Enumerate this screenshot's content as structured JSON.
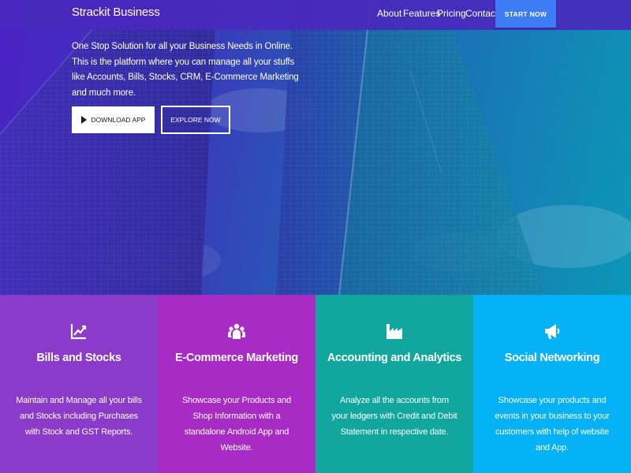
{
  "colors": {
    "nav_bg": "#4a28be",
    "cta_bg": "#3d7cf4",
    "card_1": "#8a3bc9",
    "card_2": "#a82bc6",
    "card_3": "#12a79e",
    "card_4": "#05b2f7"
  },
  "nav": {
    "brand": "Strackit Business",
    "links": [
      "About",
      "Features",
      "Pricing",
      "Contact"
    ],
    "cta": "START NOW"
  },
  "hero": {
    "tagline": "One Stop Solution for all your Business Needs in Online. This is the platform where you can manage all your stuffs like Accounts, Bills, Stocks, CRM, E-Commerce Marketing and much more.",
    "download_label": "DOWNLOAD APP",
    "explore_label": "EXPLORE NOW",
    "download_icon": "play-icon"
  },
  "features": [
    {
      "icon": "line-chart-icon",
      "title": "Bills and Stocks",
      "description": "Maintain and Manage all your bills and Stocks including Purchases with Stock and GST Reports."
    },
    {
      "icon": "users-icon",
      "title": "E-Commerce Marketing",
      "description": "Showcase your Products and Shop Information with a standalone Android App and Website."
    },
    {
      "icon": "industry-icon",
      "title": "Accounting and Analytics",
      "description": "Analyze all the accounts from your ledgers with Credit and Debit Statement in respective date."
    },
    {
      "icon": "bullhorn-icon",
      "title": "Social Networking",
      "description": "Showcase your products and events in your business to your customers with help of website and App."
    }
  ]
}
